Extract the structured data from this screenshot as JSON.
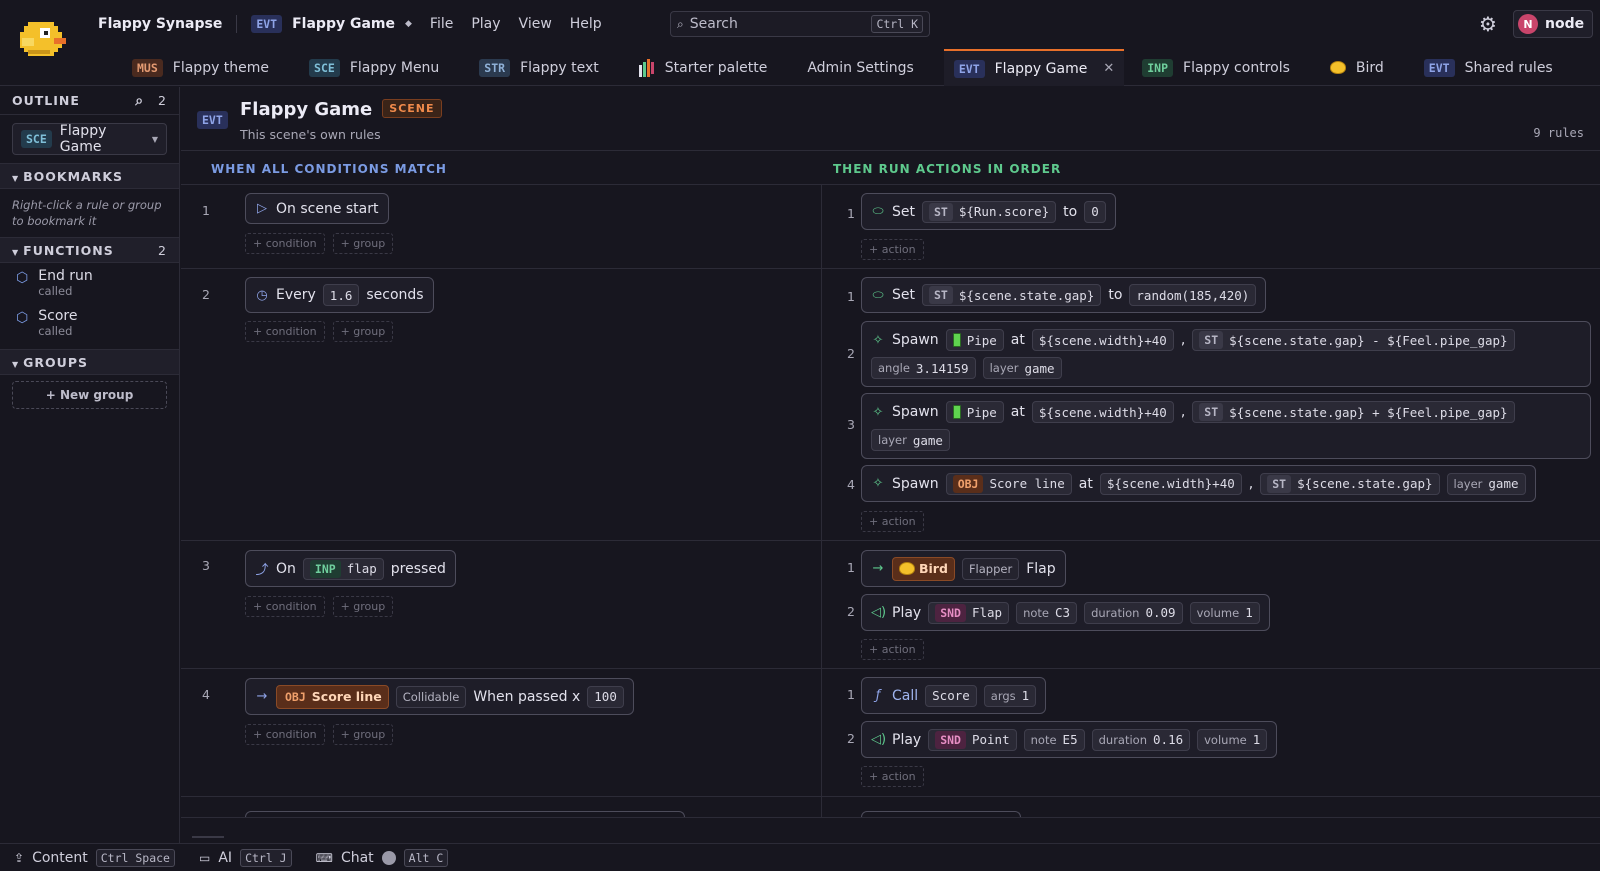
{
  "app": {
    "name": "Flappy Synapse",
    "doc_tag": "EVT",
    "doc_name": "Flappy Game",
    "menu": [
      "File",
      "Play",
      "View",
      "Help"
    ]
  },
  "search": {
    "placeholder": "Search",
    "shortcut": "Ctrl K"
  },
  "user": {
    "initial": "N",
    "name": "node"
  },
  "tabs": [
    {
      "tag": "MUS",
      "label": "Flappy theme"
    },
    {
      "tag": "SCE",
      "label": "Flappy Menu"
    },
    {
      "tag": "STR",
      "label": "Flappy text"
    },
    {
      "tag": "",
      "label": "Starter palette",
      "icon": "palette-icon"
    },
    {
      "tag": "",
      "label": "Admin Settings"
    },
    {
      "tag": "EVT",
      "label": "Flappy Game",
      "active": true
    },
    {
      "tag": "INP",
      "label": "Flappy controls"
    },
    {
      "tag": "",
      "label": "Bird",
      "icon": "bird-icon"
    },
    {
      "tag": "EVT",
      "label": "Shared rules"
    }
  ],
  "sidebar": {
    "outline_label": "OUTLINE",
    "outline_count": "2",
    "scene_tag": "SCE",
    "scene_name": "Flappy Game",
    "bookmarks_label": "BOOKMARKS",
    "bookmarks_hint": "Right-click a rule or group to bookmark it",
    "functions_label": "FUNCTIONS",
    "functions_count": "2",
    "functions": [
      {
        "name": "End run",
        "sub": "called"
      },
      {
        "name": "Score",
        "sub": "called"
      }
    ],
    "groups_label": "GROUPS",
    "new_group": "+ New group"
  },
  "event": {
    "tag": "EVT",
    "title": "Flappy Game",
    "badge": "SCENE",
    "subtitle": "This scene's own rules",
    "rule_count": "9 rules",
    "cond_header": "WHEN ALL CONDITIONS MATCH",
    "act_header": "THEN RUN ACTIONS IN ORDER",
    "add_condition": "+ condition",
    "add_group": "+ group",
    "add_action": "+ action"
  },
  "rules": {
    "r1": {
      "num": "1",
      "cond": "On scene start",
      "a1": {
        "num": "1",
        "verb": "Set",
        "tag": "ST",
        "var": "${Run.score}",
        "to": "to",
        "val": "0"
      }
    },
    "r2": {
      "num": "2",
      "cond_pre": "Every",
      "cond_val": "1.6",
      "cond_post": "seconds",
      "a1": {
        "num": "1",
        "verb": "Set",
        "tag": "ST",
        "var": "${scene.state.gap}",
        "to": "to",
        "val": "random(185,420)"
      },
      "a2": {
        "num": "2",
        "verb": "Spawn",
        "obj": "Pipe",
        "at": "at",
        "x": "${scene.width}+40",
        "comma": ",",
        "tag": "ST",
        "y": "${scene.state.gap} - ${Feel.pipe_gap}",
        "angle_lbl": "angle",
        "angle": "3.14159",
        "layer_lbl": "layer",
        "layer": "game"
      },
      "a3": {
        "num": "3",
        "verb": "Spawn",
        "obj": "Pipe",
        "at": "at",
        "x": "${scene.width}+40",
        "comma": ",",
        "tag": "ST",
        "y": "${scene.state.gap} + ${Feel.pipe_gap}",
        "layer_lbl": "layer",
        "layer": "game"
      },
      "a4": {
        "num": "4",
        "verb": "Spawn",
        "obj_tag": "OBJ",
        "obj": "Score line",
        "at": "at",
        "x": "${scene.width}+40",
        "comma": ",",
        "tag": "ST",
        "y": "${scene.state.gap}",
        "layer_lbl": "layer",
        "layer": "game"
      }
    },
    "r3": {
      "num": "3",
      "cond_pre": "On",
      "cond_tag": "INP",
      "cond_val": "flap",
      "cond_post": "pressed",
      "a1": {
        "num": "1",
        "obj": "Bird",
        "beh": "Flapper",
        "verb": "Flap"
      },
      "a2": {
        "num": "2",
        "verb": "Play",
        "tag": "SND",
        "snd": "Flap",
        "note_lbl": "note",
        "note": "C3",
        "dur_lbl": "duration",
        "dur": "0.09",
        "vol_lbl": "volume",
        "vol": "1"
      }
    },
    "r4": {
      "num": "4",
      "obj_tag": "OBJ",
      "obj": "Score line",
      "beh": "Collidable",
      "cond_text": "When passed x",
      "cond_val": "100",
      "a1": {
        "num": "1",
        "verb": "Call",
        "fn": "Score",
        "args_lbl": "args",
        "args": "1"
      },
      "a2": {
        "num": "2",
        "verb": "Play",
        "tag": "SND",
        "snd": "Point",
        "note_lbl": "note",
        "note": "E5",
        "dur_lbl": "duration",
        "dur": "0.16",
        "vol_lbl": "volume",
        "vol": "1"
      }
    }
  },
  "bottombar": {
    "content": "Content",
    "content_kbd": "Ctrl Space",
    "ai": "AI",
    "ai_kbd": "Ctrl J",
    "chat": "Chat",
    "chat_kbd": "Alt C"
  },
  "colors": {
    "accent_tab": "#e8702a",
    "cond_header": "#7b9be3",
    "act_header": "#5ec98d"
  }
}
